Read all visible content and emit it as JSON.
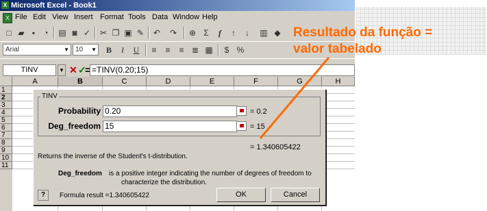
{
  "window": {
    "title": "Microsoft Excel - Book1"
  },
  "menu": [
    "File",
    "Edit",
    "View",
    "Insert",
    "Format",
    "Tools",
    "Data",
    "Window",
    "Help"
  ],
  "format_toolbar": {
    "font_name": "Arial",
    "font_size": "10"
  },
  "formula_bar": {
    "name_box": "TINV",
    "cancel_symbol": "✕",
    "enter_symbol": "✓",
    "equals_symbol": "=",
    "formula": "=TINV(0.20;15)"
  },
  "columns": [
    "A",
    "B",
    "C",
    "D",
    "E",
    "F",
    "G",
    "H"
  ],
  "rows": [
    "1",
    "2",
    "3",
    "4",
    "5",
    "6",
    "7",
    "8",
    "9",
    "10",
    "11"
  ],
  "active_cell": {
    "column": "B",
    "row": "2"
  },
  "dialog": {
    "function_name": "TINV",
    "args": [
      {
        "label": "Probability",
        "value": "0.20",
        "result": "= 0.2"
      },
      {
        "label": "Deg_freedom",
        "value": "15",
        "result": "= 15"
      }
    ],
    "function_result": "= 1.340605422",
    "description": "Returns the inverse of the Student's t-distribution.",
    "arg_help_name": "Deg_freedom",
    "arg_help_line1": "is a positive integer indicating the number of degrees of freedom to",
    "arg_help_line2": "characterize the distribution.",
    "formula_result": "Formula result =1.340605422",
    "help_label": "?",
    "ok_label": "OK",
    "cancel_label": "Cancel"
  },
  "annotation": {
    "line1": "Resultado da função =",
    "line2": "valor tabelado",
    "color": "#ff6a00"
  }
}
